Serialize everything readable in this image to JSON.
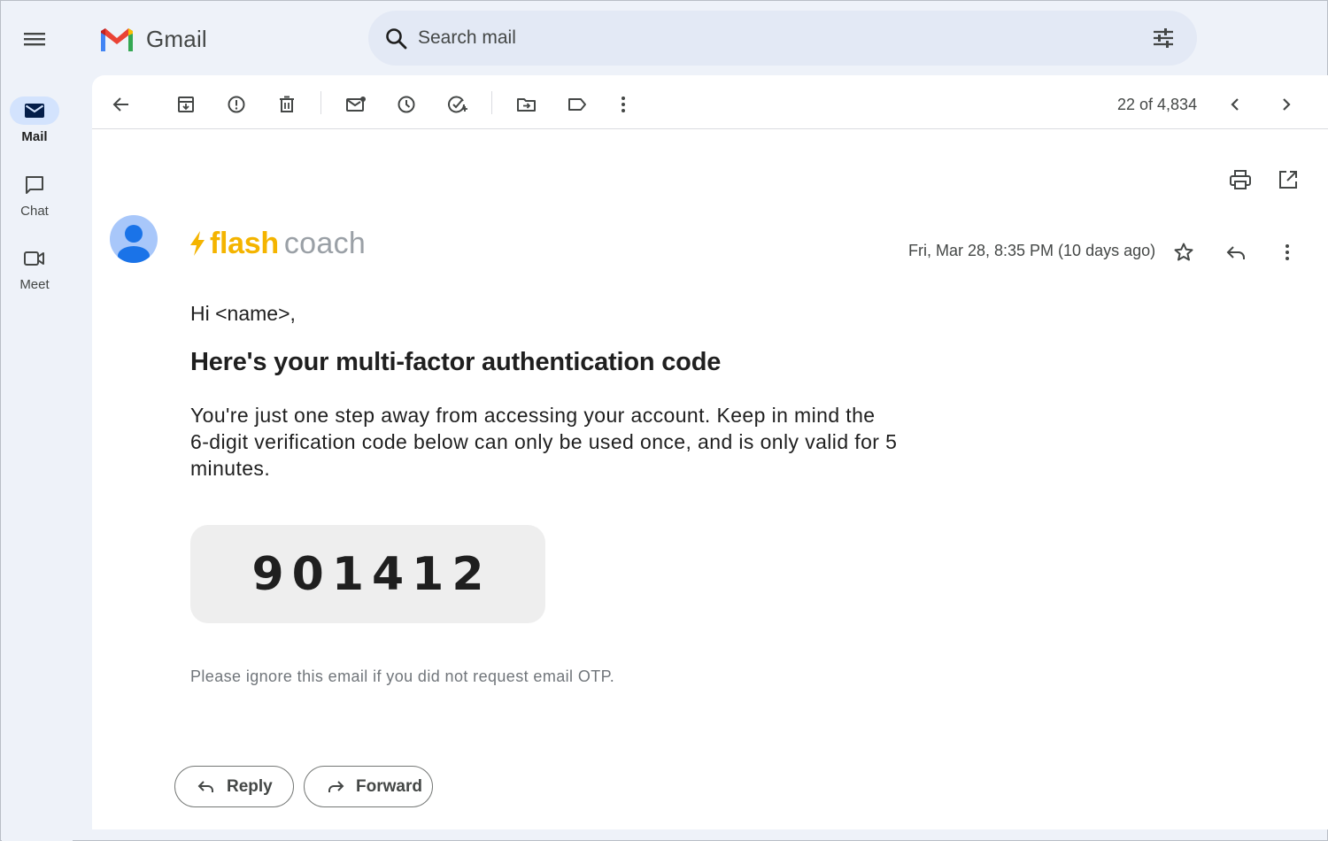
{
  "app": {
    "name": "Gmail",
    "brand_colors": {
      "blue": "#4285F4",
      "red": "#EA4335",
      "yellow": "#FBBC04",
      "green": "#34A853"
    }
  },
  "rail": {
    "items": [
      {
        "label": "Mail",
        "icon": "mail-icon",
        "active": true
      },
      {
        "label": "Chat",
        "icon": "chat-icon",
        "active": false
      },
      {
        "label": "Meet",
        "icon": "video-icon",
        "active": false
      }
    ]
  },
  "search": {
    "placeholder": "Search mail"
  },
  "toolbar": {
    "pager": "22 of 4,834",
    "icons": [
      "back-arrow-icon",
      "archive-icon",
      "report-spam-icon",
      "delete-icon",
      "mark-unread-icon",
      "snooze-icon",
      "add-task-icon",
      "move-to-icon",
      "label-icon",
      "more-vert-icon"
    ]
  },
  "message": {
    "sender_logo_part1": "flash",
    "sender_logo_part2": "coach",
    "date": "Fri, Mar 28, 8:35 PM (10 days ago)",
    "greeting": "Hi <name>,",
    "headline": "Here's your multi-factor authentication code",
    "body": "You're just one step away from accessing your account. Keep in mind the 6-digit verification code below can only be used once, and is only valid for 5 minutes.",
    "code": "901412",
    "footnote": "Please ignore this email if you did not request email OTP.",
    "accent_color": "#f4b400"
  },
  "actions": {
    "reply_label": "Reply",
    "forward_label": "Forward"
  }
}
